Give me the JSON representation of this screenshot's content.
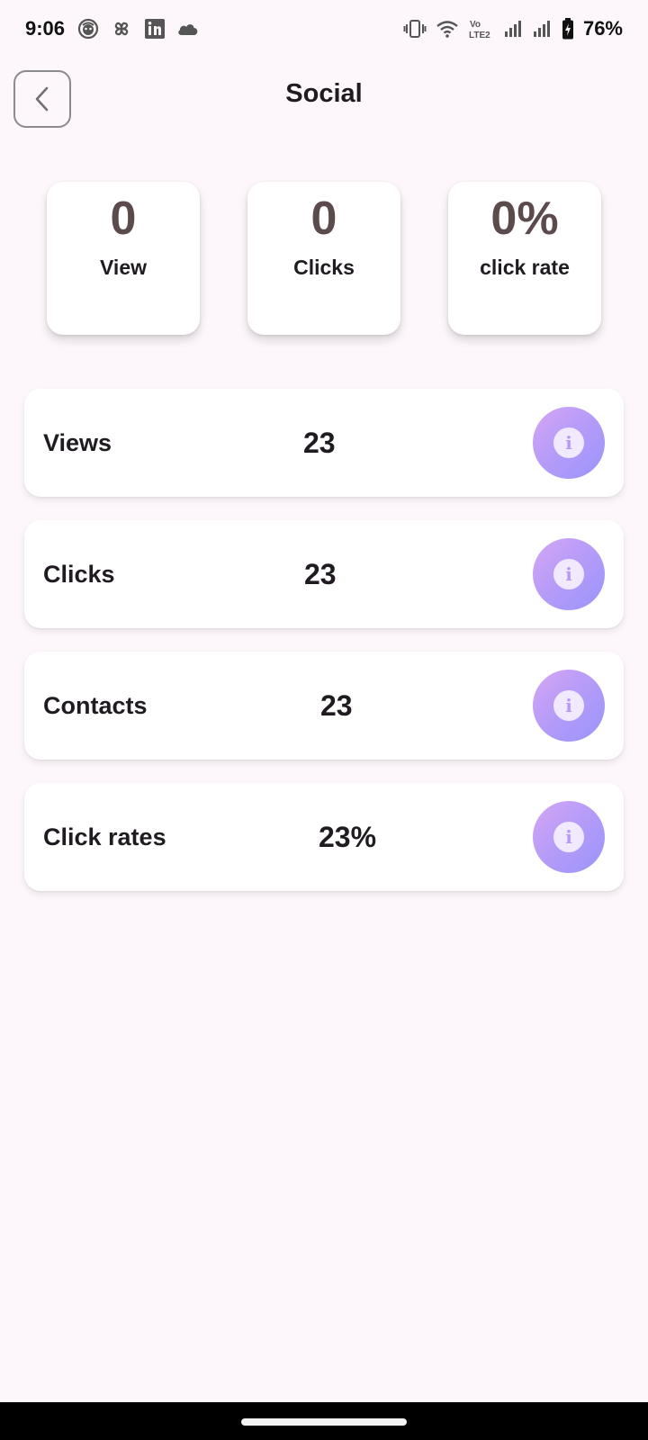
{
  "status_bar": {
    "time": "9:06",
    "battery": "76%",
    "left_icons": [
      "face-icon",
      "pinwheel-icon",
      "linkedin-icon",
      "cloud-icon"
    ],
    "right_icons": [
      "vibrate-icon",
      "wifi-icon",
      "volte-icon",
      "signal-icon",
      "signal-icon",
      "battery-icon"
    ],
    "volte_text": "Vo LTE2"
  },
  "header": {
    "title": "Social",
    "back_icon": "chevron-left-icon"
  },
  "summary": [
    {
      "value": "0",
      "label": "View"
    },
    {
      "value": "0",
      "label": "Clicks"
    },
    {
      "value": "0%",
      "label": "click rate"
    }
  ],
  "metrics": [
    {
      "label": "Views",
      "value": "23",
      "icon": "info-icon"
    },
    {
      "label": "Clicks",
      "value": "23",
      "icon": "info-icon"
    },
    {
      "label": "Contacts",
      "value": "23",
      "icon": "info-icon"
    },
    {
      "label": "Click rates",
      "value": "23%",
      "icon": "info-icon"
    }
  ],
  "info_glyph": "i",
  "colors": {
    "background": "#fdf7fb",
    "summary_value": "#5c4b4d",
    "info_gradient_start": "#d5a6f5",
    "info_gradient_end": "#9a94fb"
  }
}
